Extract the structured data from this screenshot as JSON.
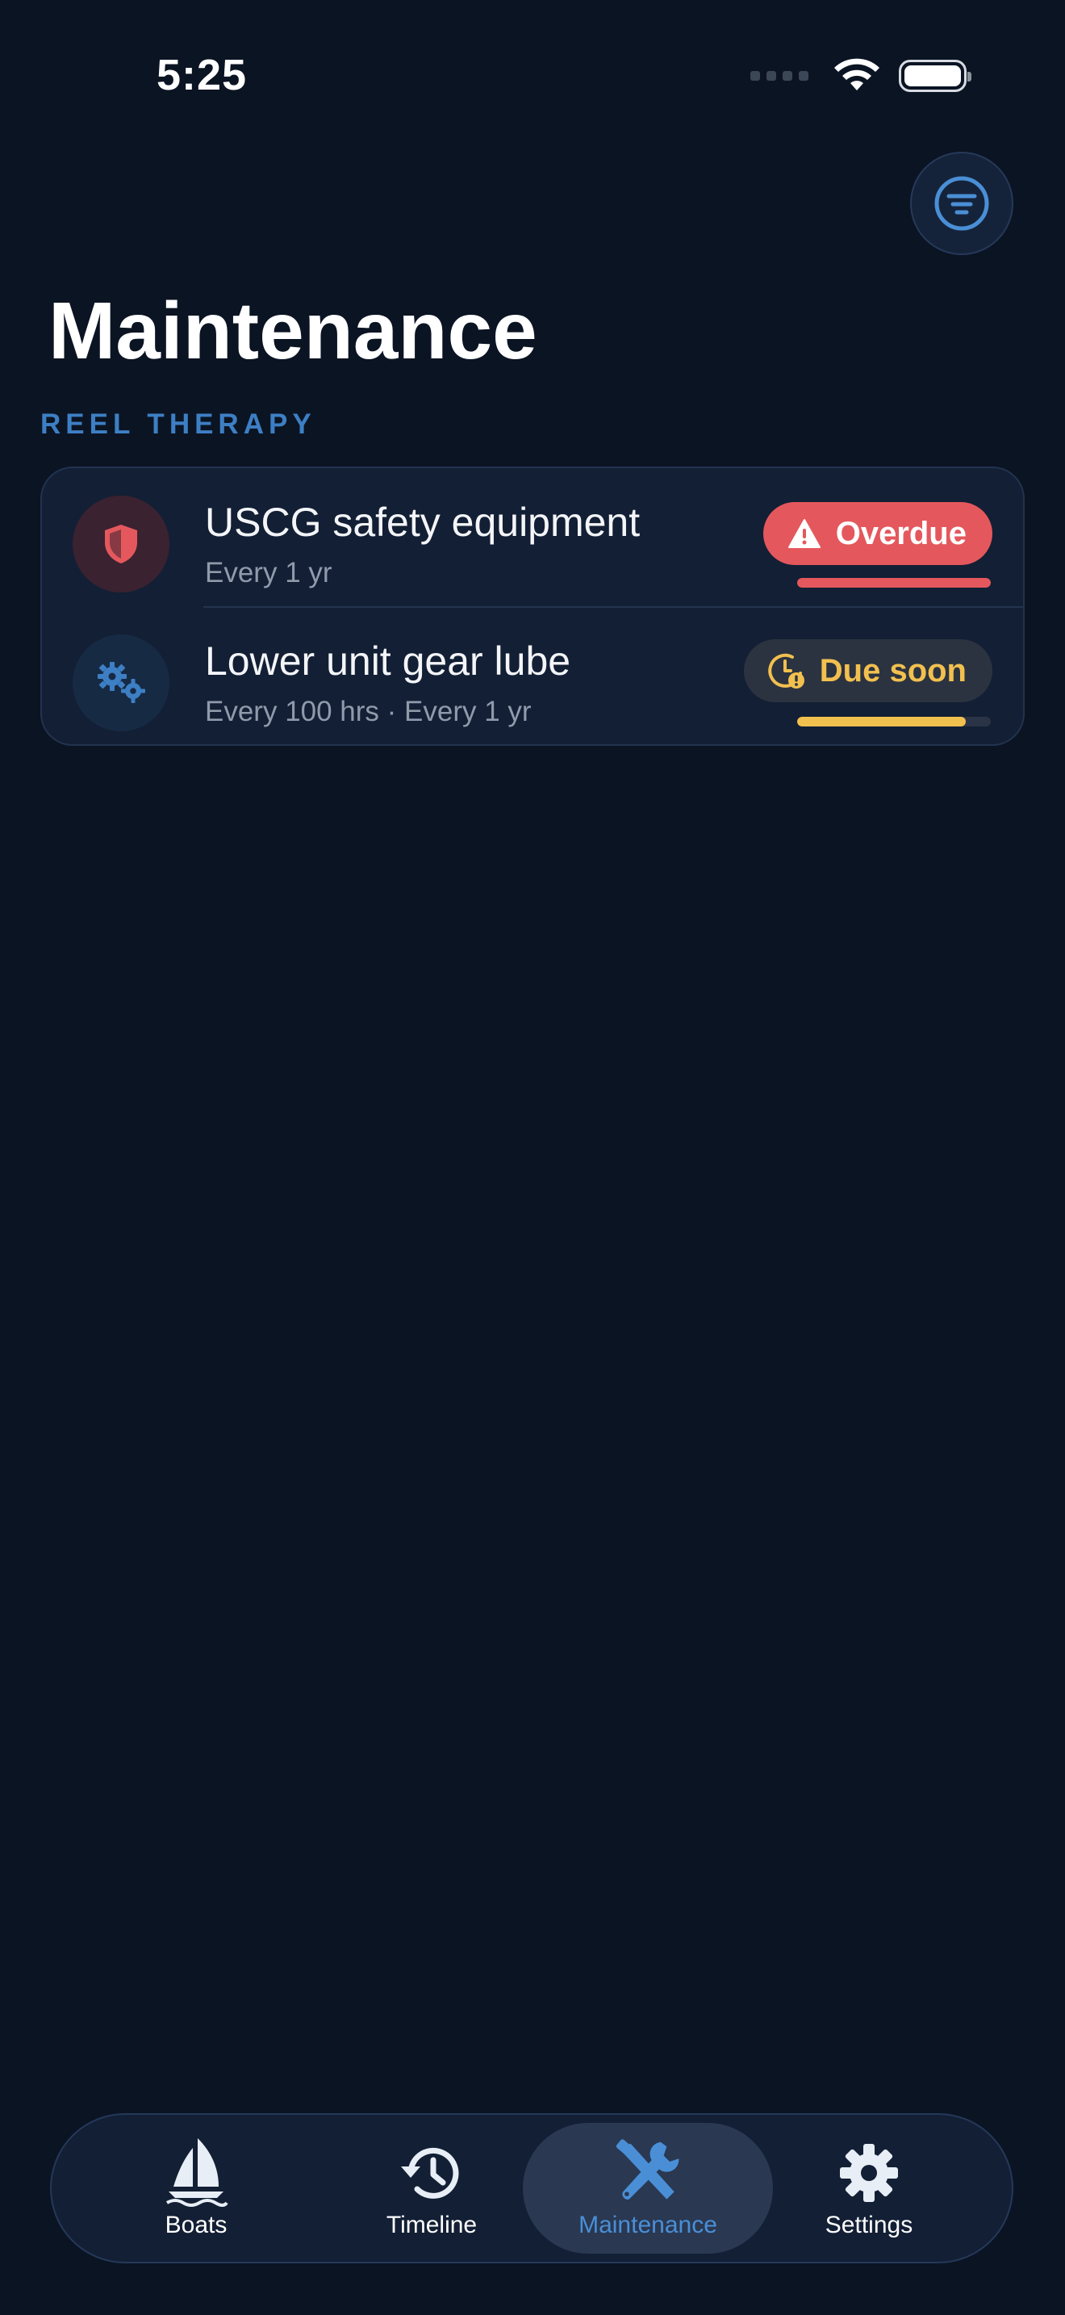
{
  "status_bar": {
    "time": "5:25"
  },
  "header": {
    "title": "Maintenance",
    "filter_icon": "filter-lines-icon"
  },
  "section": {
    "label": "REEL THERAPY"
  },
  "items": [
    {
      "title": "USCG safety equipment",
      "subtitle": "Every 1 yr",
      "icon": "shield-icon",
      "status_label": "Overdue",
      "status_icon": "warning-triangle-icon",
      "status_color": "#e4585d",
      "progress": 1.0
    },
    {
      "title": "Lower unit gear lube",
      "subtitle": "Every 100 hrs · Every 1 yr",
      "icon": "gears-icon",
      "status_label": "Due soon",
      "status_icon": "clock-alert-icon",
      "status_color": "#f2c04f",
      "progress": 0.87
    }
  ],
  "tabbar": {
    "active": "Maintenance",
    "tabs": [
      {
        "label": "Boats",
        "icon": "sailboat-icon"
      },
      {
        "label": "Timeline",
        "icon": "history-clock-icon"
      },
      {
        "label": "Maintenance",
        "icon": "tools-icon"
      },
      {
        "label": "Settings",
        "icon": "gear-icon"
      }
    ]
  },
  "colors": {
    "background": "#0b1423",
    "card": "#131f34",
    "accent": "#4a8fd6",
    "section_label": "#3d7fc4",
    "overdue": "#e4585d",
    "due_soon": "#f2c04f"
  }
}
